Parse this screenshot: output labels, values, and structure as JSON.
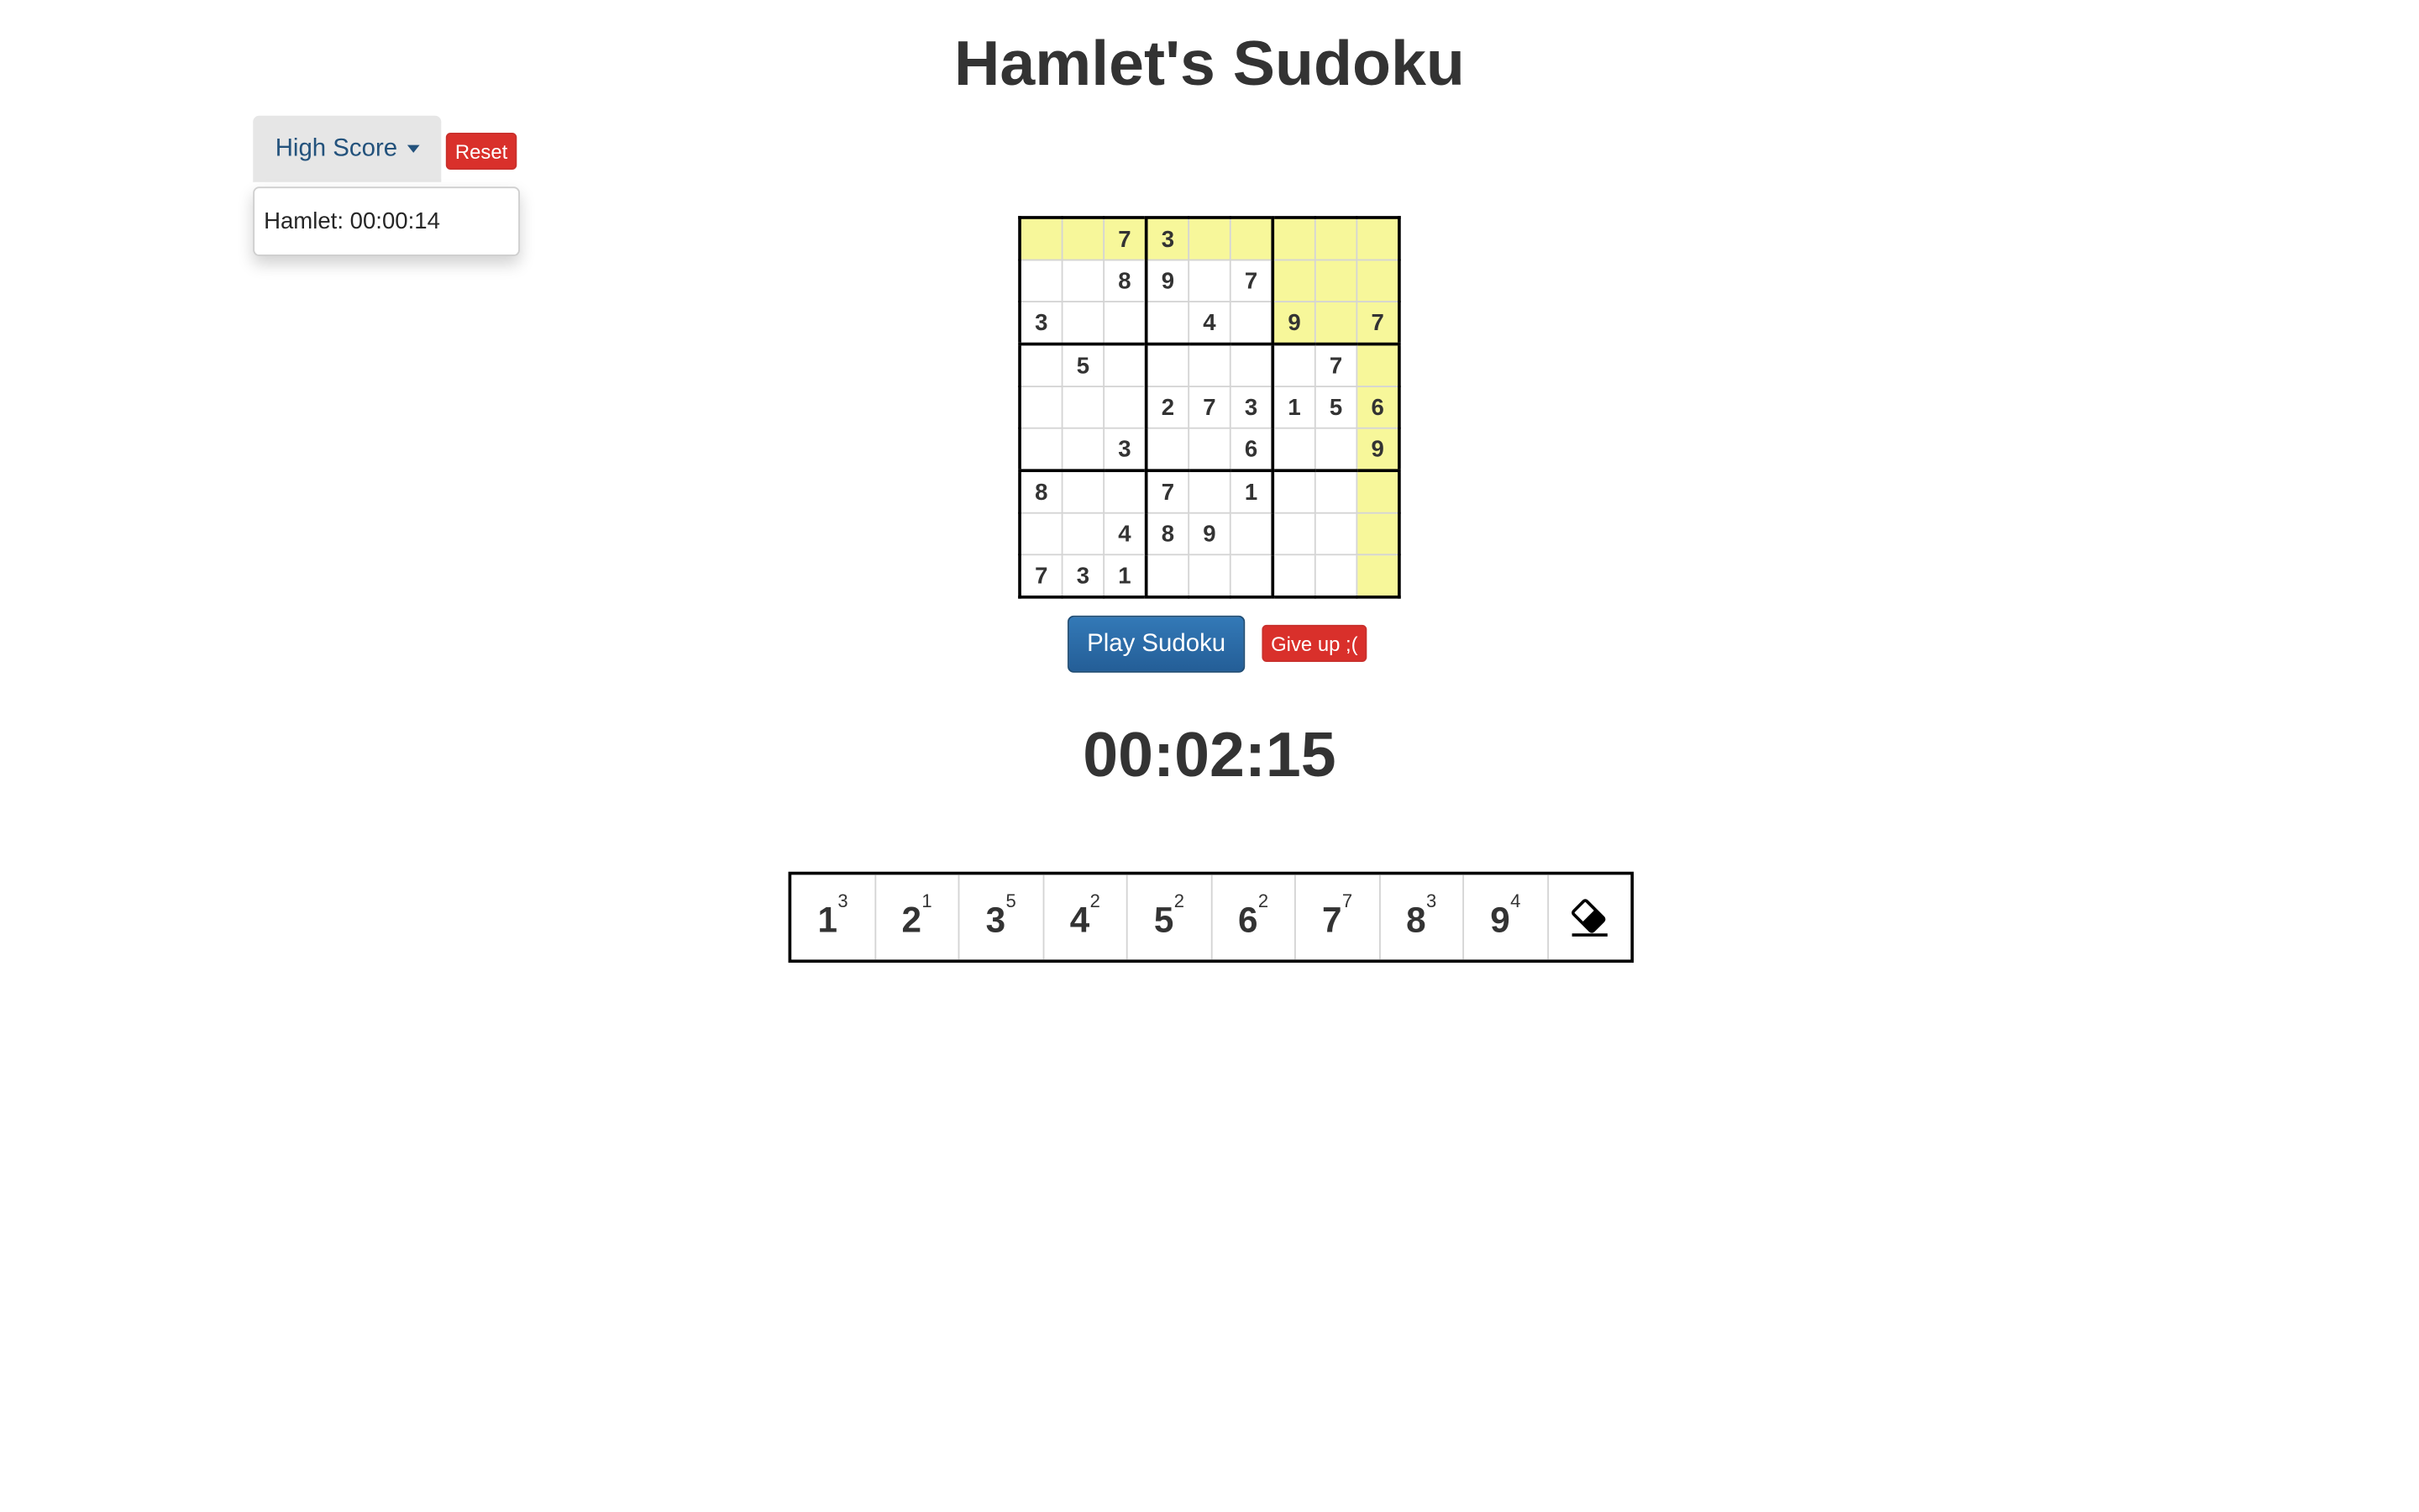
{
  "title": "Hamlet's Sudoku",
  "high_score": {
    "toggle_label": "High Score",
    "reset_label": "Reset",
    "entries": [
      "Hamlet: 00:00:14"
    ]
  },
  "board": {
    "cells": [
      [
        "",
        "",
        "7",
        "3",
        "",
        "",
        "",
        "",
        ""
      ],
      [
        "",
        "",
        "8",
        "9",
        "",
        "7",
        "",
        "",
        ""
      ],
      [
        "3",
        "",
        "",
        "",
        "4",
        "",
        "9",
        "",
        "7"
      ],
      [
        "",
        "5",
        "",
        "",
        "",
        "",
        "",
        "7",
        ""
      ],
      [
        "",
        "",
        "",
        "2",
        "7",
        "3",
        "1",
        "5",
        "6"
      ],
      [
        "",
        "",
        "3",
        "",
        "",
        "6",
        "",
        "",
        "9"
      ],
      [
        "8",
        "",
        "",
        "7",
        "",
        "1",
        "",
        "",
        ""
      ],
      [
        "",
        "",
        "4",
        "8",
        "9",
        "",
        "",
        "",
        ""
      ],
      [
        "7",
        "3",
        "1",
        "",
        "",
        "",
        "",
        "",
        ""
      ]
    ],
    "highlighted": [
      [
        0,
        0
      ],
      [
        0,
        1
      ],
      [
        0,
        2
      ],
      [
        0,
        3
      ],
      [
        0,
        4
      ],
      [
        0,
        5
      ],
      [
        0,
        6
      ],
      [
        0,
        7
      ],
      [
        0,
        8
      ],
      [
        1,
        6
      ],
      [
        1,
        7
      ],
      [
        1,
        8
      ],
      [
        2,
        6
      ],
      [
        2,
        7
      ],
      [
        2,
        8
      ],
      [
        3,
        8
      ],
      [
        4,
        8
      ],
      [
        5,
        8
      ],
      [
        6,
        8
      ],
      [
        7,
        8
      ],
      [
        8,
        8
      ]
    ],
    "highlight_color": "#f7f79a"
  },
  "buttons": {
    "play_label": "Play Sudoku",
    "giveup_label": "Give up ;("
  },
  "timer": "00:02:15",
  "numpad": {
    "keys": [
      {
        "digit": "1",
        "count": "3"
      },
      {
        "digit": "2",
        "count": "1"
      },
      {
        "digit": "3",
        "count": "5"
      },
      {
        "digit": "4",
        "count": "2"
      },
      {
        "digit": "5",
        "count": "2"
      },
      {
        "digit": "6",
        "count": "2"
      },
      {
        "digit": "7",
        "count": "7"
      },
      {
        "digit": "8",
        "count": "3"
      },
      {
        "digit": "9",
        "count": "4"
      }
    ],
    "eraser_icon": "eraser-icon"
  },
  "colors": {
    "primary": "#296fb0",
    "danger": "#d9302b",
    "link": "#23527c"
  }
}
